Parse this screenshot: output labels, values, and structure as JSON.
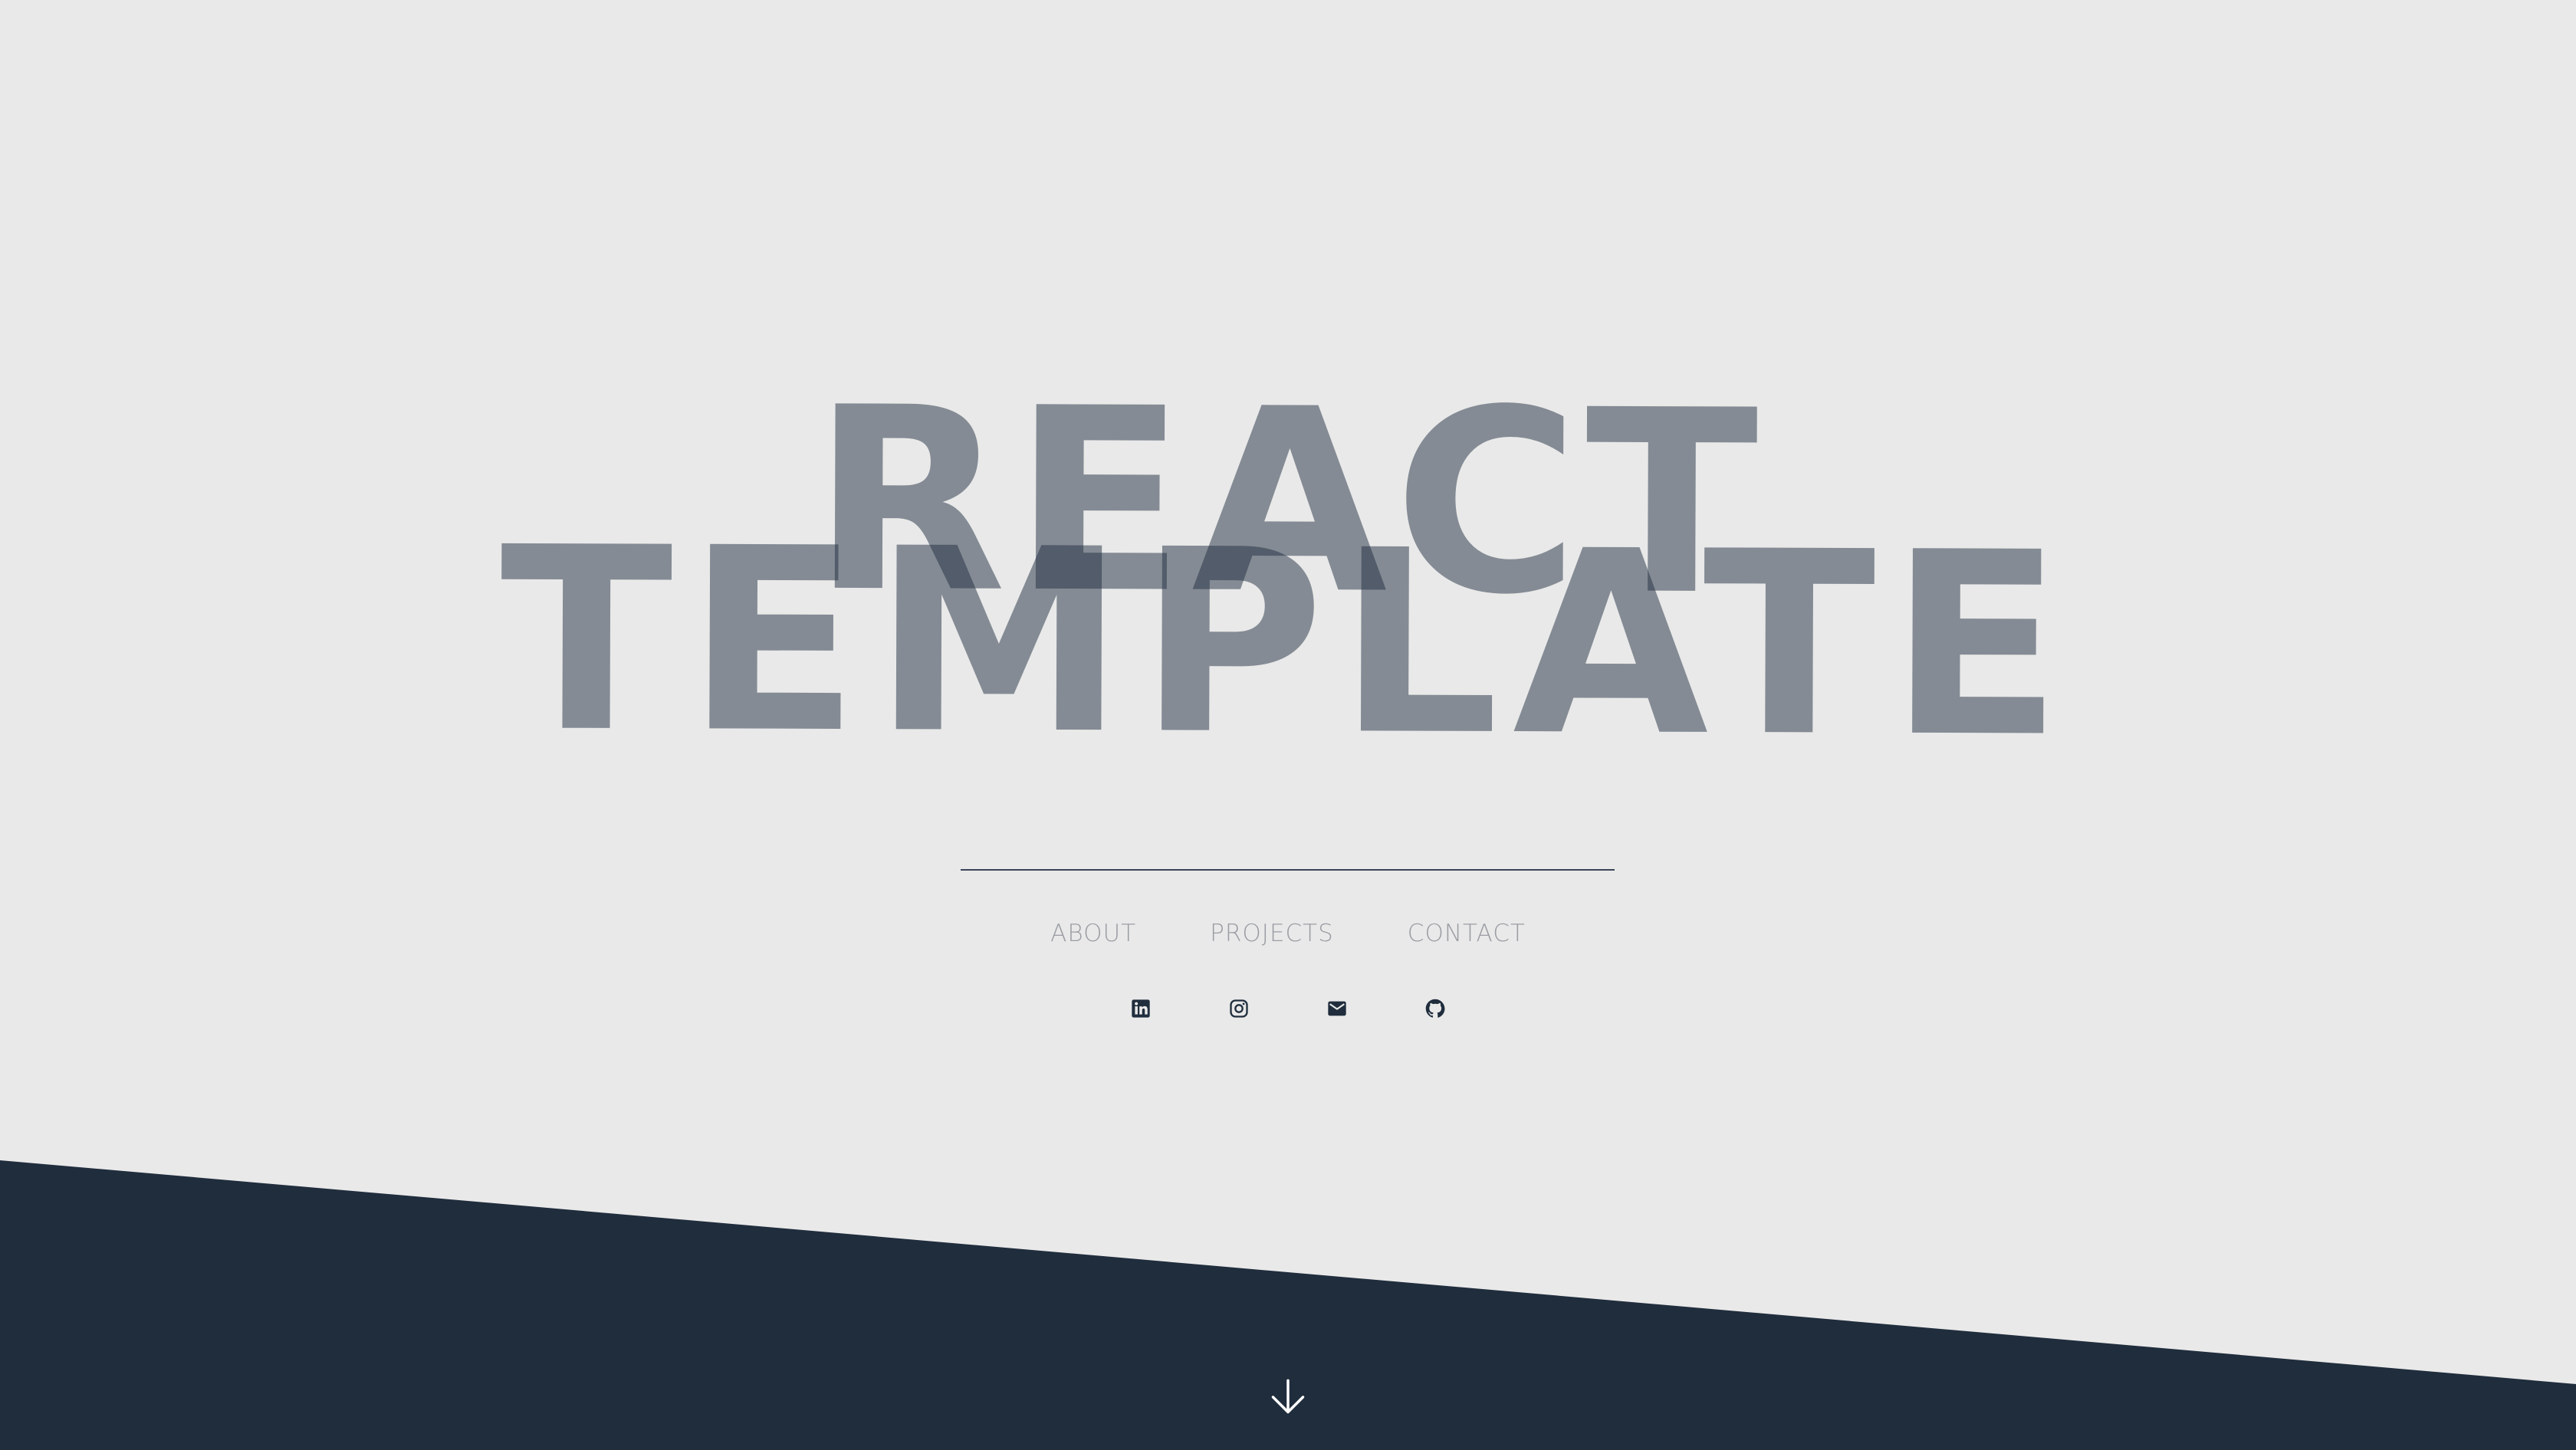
{
  "hero": {
    "title_line_1": "REACT",
    "title_line_2": "TEMPLATE"
  },
  "nav": {
    "items": [
      {
        "label": "ABOUT"
      },
      {
        "label": "PROJECTS"
      },
      {
        "label": "CONTACT"
      }
    ]
  },
  "socials": {
    "items": [
      {
        "icon": "linkedin-icon"
      },
      {
        "icon": "instagram-icon"
      },
      {
        "icon": "mail-icon"
      },
      {
        "icon": "github-icon"
      }
    ]
  },
  "scroll": {
    "icon": "arrow-down-icon"
  },
  "colors": {
    "background": "#e9e9e9",
    "band": "#202d3d",
    "title": "rgba(32,45,64,0.5)",
    "nav_text": "#9a9da3",
    "icon": "#202d3d"
  }
}
